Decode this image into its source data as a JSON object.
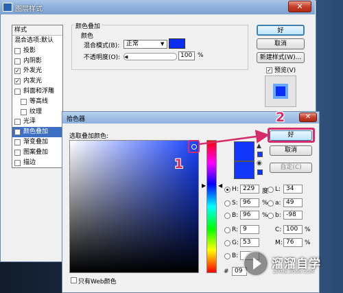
{
  "layer_style": {
    "title": "图层样式",
    "close_glyph": "✕",
    "styles_header": "样式",
    "items": [
      {
        "label": "混合选项:默认",
        "checked": false,
        "selected": false,
        "has_checkbox": false
      },
      {
        "label": "投影",
        "checked": false,
        "selected": false,
        "has_checkbox": true
      },
      {
        "label": "内阴影",
        "checked": false,
        "selected": false,
        "has_checkbox": true
      },
      {
        "label": "外发光",
        "checked": true,
        "selected": false,
        "has_checkbox": true
      },
      {
        "label": "内发光",
        "checked": true,
        "selected": false,
        "has_checkbox": true
      },
      {
        "label": "斜面和浮雕",
        "checked": false,
        "selected": false,
        "has_checkbox": true
      },
      {
        "label": "等高线",
        "checked": false,
        "selected": false,
        "has_checkbox": true
      },
      {
        "label": "纹理",
        "checked": false,
        "selected": false,
        "has_checkbox": true
      },
      {
        "label": "光泽",
        "checked": false,
        "selected": false,
        "has_checkbox": true
      },
      {
        "label": "颜色叠加",
        "checked": true,
        "selected": true,
        "has_checkbox": true
      },
      {
        "label": "渐变叠加",
        "checked": false,
        "selected": false,
        "has_checkbox": true
      },
      {
        "label": "图案叠加",
        "checked": false,
        "selected": false,
        "has_checkbox": true
      },
      {
        "label": "描边",
        "checked": false,
        "selected": false,
        "has_checkbox": true
      }
    ],
    "overlay_group_title": "颜色叠加",
    "overlay_sub_title": "颜色",
    "blend_mode_label": "混合模式(B):",
    "blend_mode_value": "正常",
    "opacity_label": "不透明度(O):",
    "opacity_value": "100",
    "opacity_unit": "%",
    "overlay_color": "#0a2ef5",
    "buttons": {
      "ok": "好",
      "cancel": "取消",
      "new_style": "新建样式(W)..."
    },
    "preview_label": "预览(V)",
    "preview_checked": true
  },
  "color_picker": {
    "title": "拾色器",
    "close_glyph": "✕",
    "prompt": "选取叠加颜色:",
    "buttons": {
      "ok": "好",
      "cancel": "取消",
      "custom": "自定(C)"
    },
    "new_color": "#1435fa",
    "current_color": "#1336f7",
    "hsb": [
      {
        "label": "H:",
        "value": "229",
        "unit": "度",
        "selected": true
      },
      {
        "label": "S:",
        "value": "96",
        "unit": "%",
        "selected": false
      },
      {
        "label": "B:",
        "value": "96",
        "unit": "%",
        "selected": false
      }
    ],
    "lab": [
      {
        "label": "L:",
        "value": "34"
      },
      {
        "label": "a:",
        "value": "49"
      },
      {
        "label": "b:",
        "value": "-98"
      }
    ],
    "rgb": [
      {
        "label": "R:",
        "value": "9"
      },
      {
        "label": "G:",
        "value": "53"
      },
      {
        "label": "B:",
        "value": ""
      }
    ],
    "cmyk": [
      {
        "label": "C:",
        "value": "100",
        "unit": "%"
      },
      {
        "label": "M:",
        "value": "76",
        "unit": "%"
      }
    ],
    "hex_label": "#",
    "hex_value": "09",
    "web_only_label": "只有Web颜色"
  },
  "annotations": {
    "step1": "1",
    "step2": "2",
    "color": "#d62c6a"
  },
  "watermark": {
    "text": "溜溜自学",
    "sub": "ZIXUE.3066.COM"
  }
}
